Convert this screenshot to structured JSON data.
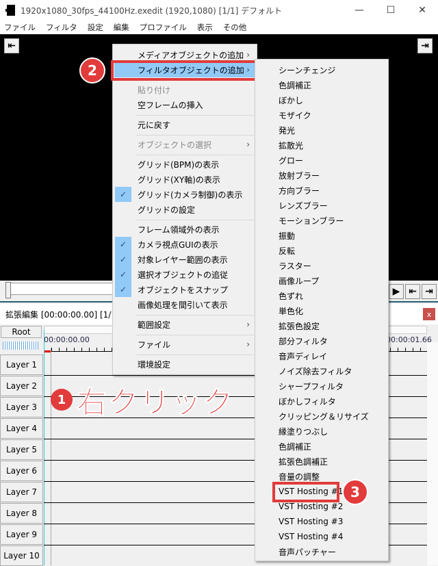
{
  "window": {
    "title": "1920x1080_30fps_44100Hz.exedit (1920,1080)  [1/1]  デフォルト",
    "minimize": "—",
    "maximize": "☐",
    "close": "✕"
  },
  "menubar": [
    "ファイル",
    "フィルタ",
    "設定",
    "編集",
    "プロファイル",
    "表示",
    "その他"
  ],
  "preview": {
    "prev_icon": "⇤",
    "next_icon": "⇥"
  },
  "playback": {
    "buttons": [
      "▶",
      "⇤",
      "⇥"
    ]
  },
  "ext_edit": {
    "header": "拡張編集 [00:00:00.00] [1/1]",
    "close": "x",
    "root": "Root",
    "time_start": "00:00:00.00",
    "time_end": "00:00:01.66",
    "layers": [
      "Layer 1",
      "Layer 2",
      "Layer 3",
      "Layer 4",
      "Layer 5",
      "Layer 6",
      "Layer 7",
      "Layer 8",
      "Layer 9",
      "Layer 10"
    ]
  },
  "context_menu": {
    "items": [
      {
        "label": "メディアオブジェクトの追加",
        "submenu": true
      },
      {
        "label": "フィルタオブジェクトの追加",
        "submenu": true,
        "highlighted": true
      },
      {
        "label": "貼り付け",
        "disabled": true
      },
      {
        "label": "空フレームの挿入"
      },
      {
        "label": "元に戻す"
      },
      {
        "label": "オブジェクトの選択",
        "disabled": true,
        "submenu": true
      },
      {
        "label": "グリッド(BPM)の表示"
      },
      {
        "label": "グリッド(XY軸)の表示"
      },
      {
        "label": "グリッド(カメラ制御)の表示",
        "checked": true
      },
      {
        "label": "グリッドの設定"
      },
      {
        "label": "フレーム領域外の表示"
      },
      {
        "label": "カメラ視点GUIの表示",
        "checked": true
      },
      {
        "label": "対象レイヤー範囲の表示",
        "checked": true
      },
      {
        "label": "選択オブジェクトの追従",
        "checked": true
      },
      {
        "label": "オブジェクトをスナップ",
        "checked": true
      },
      {
        "label": "画像処理を間引いて表示"
      },
      {
        "label": "範囲設定",
        "submenu": true
      },
      {
        "label": "ファイル",
        "submenu": true
      },
      {
        "label": "環境設定"
      }
    ],
    "arrow": "›",
    "check": "✓"
  },
  "filter_submenu": {
    "items": [
      "シーンチェンジ",
      "色調補正",
      "ぼかし",
      "モザイク",
      "発光",
      "拡散光",
      "グロー",
      "放射ブラー",
      "方向ブラー",
      "レンズブラー",
      "モーションブラー",
      "振動",
      "反転",
      "ラスター",
      "画像ループ",
      "色ずれ",
      "単色化",
      "拡張色設定",
      "部分フィルタ",
      "音声ディレイ",
      "ノイズ除去フィルタ",
      "シャープフィルタ",
      "ぼかしフィルタ",
      "クリッピング＆リサイズ",
      "縁塗りつぶし",
      "色調補正",
      "拡張色調補正",
      "音量の調整",
      "VST Hosting #1",
      "VST Hosting #2",
      "VST Hosting #3",
      "VST Hosting #4",
      "音声パッチャー"
    ]
  },
  "annotations": {
    "step1_number": "1",
    "step1_text": "右クリック",
    "step2_number": "2",
    "step3_number": "3",
    "color": "#e23b3b"
  }
}
